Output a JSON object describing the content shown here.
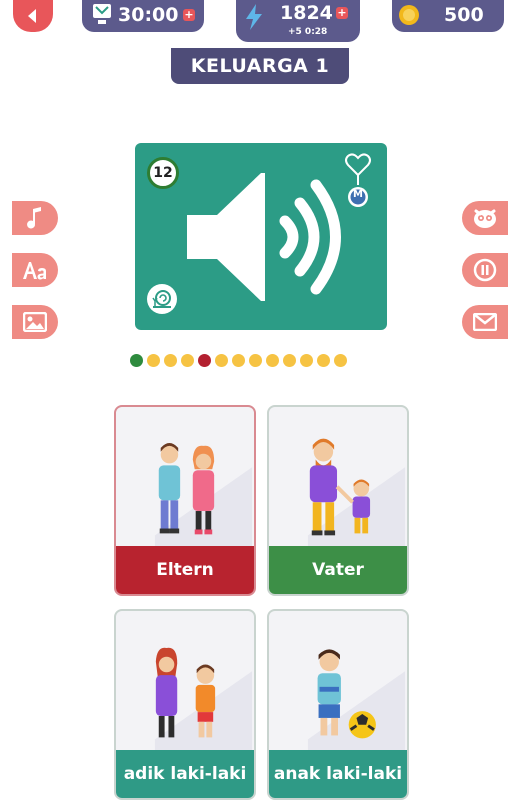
{
  "header": {
    "timer": "30:00",
    "energy": "1824",
    "energy_sub": "+5 0:28",
    "coins": "500",
    "plus_symbol": "+",
    "pill_color": "#5c5a8c",
    "accent_red": "#e8565a"
  },
  "title": "KELUARGA 1",
  "audio_card": {
    "level": "12",
    "mnemonic_badge": "M",
    "bg_color": "#2c9c86"
  },
  "left_tools": [
    {
      "icon": "music-note-icon"
    },
    {
      "icon": "font-icon"
    },
    {
      "icon": "image-icon"
    }
  ],
  "right_tools": [
    {
      "icon": "mascot-icon"
    },
    {
      "icon": "pause-icon"
    },
    {
      "icon": "mail-icon"
    }
  ],
  "progress": {
    "total": 13,
    "current": 6,
    "colors": [
      "#2e8b3e",
      "#f6c343",
      "#f6c343",
      "#f6c343",
      "#b32030",
      "#f6c343",
      "#f6c343",
      "#f6c343",
      "#f6c343",
      "#f6c343",
      "#f6c343",
      "#f6c343",
      "#f6c343"
    ]
  },
  "answers": [
    {
      "label": "Eltern",
      "state": "wrong",
      "color": "#b8232f"
    },
    {
      "label": "Vater",
      "state": "correct",
      "color": "#3d8f47"
    },
    {
      "label": "adik laki-laki",
      "state": "default",
      "color": "#2f9a86"
    },
    {
      "label": "anak laki-laki",
      "state": "default",
      "color": "#2f9a86"
    }
  ]
}
